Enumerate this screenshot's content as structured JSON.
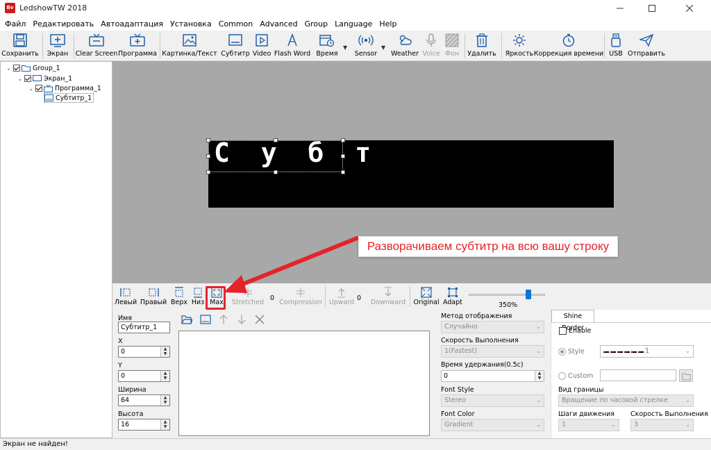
{
  "window": {
    "title": "LedshowTW 2018",
    "app_icon": "Bv"
  },
  "menu": [
    "Файл",
    "Редактировать",
    "Автоадаптация",
    "Установка",
    "Common",
    "Advanced",
    "Group",
    "Language",
    "Help"
  ],
  "toolbar": {
    "save": "Сохранить",
    "screen": "Экран",
    "clear_screen": "Clear Screen",
    "program": "Программа",
    "image_text": "Картинка/Текст",
    "subtitle": "Субтитр",
    "video": "Video",
    "flash_word": "Flash Word",
    "time": "Время",
    "sensor": "Sensor",
    "weather": "Weather",
    "voice": "Voice",
    "background": "Фон",
    "delete": "Удалить",
    "brightness": "Яркость",
    "time_correction": "Коррекция времени",
    "usb": "USB",
    "send": "Отправить"
  },
  "tree": {
    "group": "Group_1",
    "screen": "Экран_1",
    "program": "Программа_1",
    "subtitle": "Субтитр_1"
  },
  "canvas": {
    "led_text": "С у б т",
    "accent_color": "#e3242b"
  },
  "callout": "Разворачиваем субтитр на всю вашу строку",
  "align_toolbar": {
    "left": "Левый",
    "right": "Правый",
    "top": "Верх",
    "bottom": "Низ",
    "max": "Max",
    "stretched": "Stretched",
    "stretched_value": "0",
    "compression": "Compression",
    "compression_value": "0",
    "upward": "Upward",
    "upward_value": "0",
    "downward": "Downward",
    "original": "Original",
    "adapt": "Adapt",
    "zoom": "350%",
    "zoom_level": 0.8
  },
  "props": {
    "name_label": "Имя",
    "name_value": "Субтитр_1",
    "x_label": "X",
    "x_value": "0",
    "y_label": "Y",
    "y_value": "0",
    "width_label": "Ширина",
    "width_value": "64",
    "height_label": "Высота",
    "height_value": "16"
  },
  "display": {
    "method_label": "Метод отображения",
    "method_value": "Случайно",
    "speed_label": "Скорость Выполнения",
    "speed_value": "1(Fastest)",
    "hold_label": "Время удержания(0.5с)",
    "hold_value": "0",
    "font_style_label": "Font Style",
    "font_style_value": "Stereo",
    "font_color_label": "Font Color",
    "font_color_value": "Gradient"
  },
  "shine": {
    "tab": "Shine Border",
    "enable": "Enable",
    "style": "Style",
    "style_value": "1",
    "custom": "Custom",
    "border_view_label": "Вид границы",
    "border_view_value": "Вращение по часовой стрелке",
    "steps_label": "Шаги движения",
    "steps_value": "1",
    "speed_label": "Скорость Выполнения",
    "speed_value": "3"
  },
  "status": "Экран не найден!"
}
